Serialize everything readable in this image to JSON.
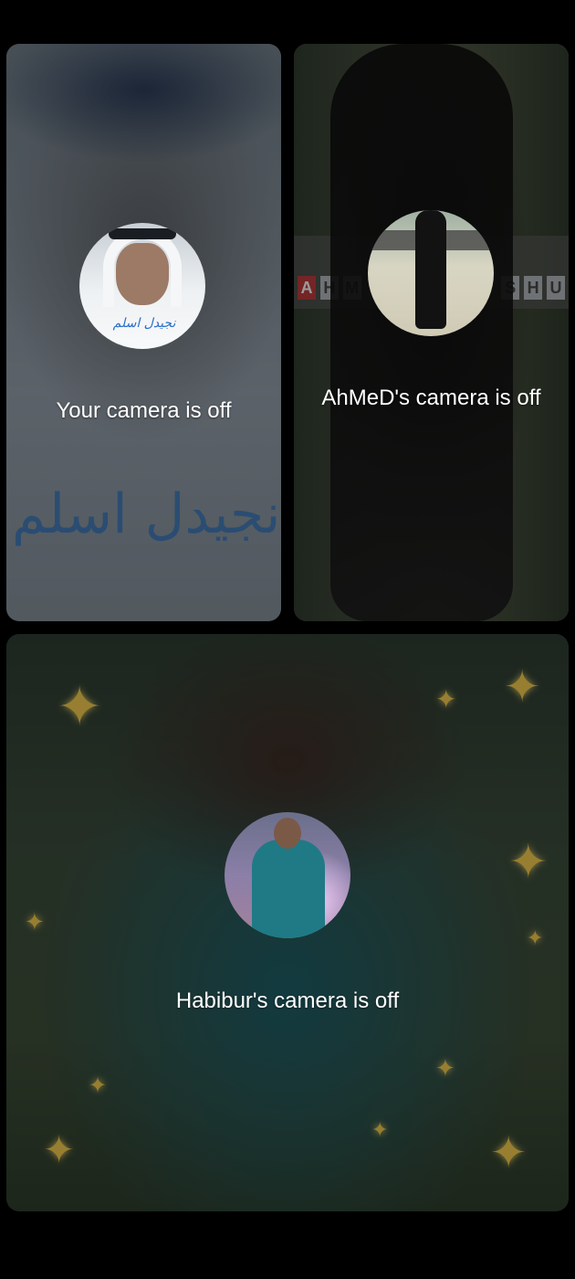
{
  "tiles": {
    "you": {
      "status": "Your camera is off",
      "avatar_caption": "نجيدل اسلم",
      "watermark": "نجيدل اسلم"
    },
    "ahmed": {
      "status": "AhMeD's camera is off",
      "banner_letters": [
        "A",
        "H",
        "M",
        "",
        "",
        "",
        "",
        "",
        "",
        "S",
        "H",
        "U"
      ]
    },
    "habibur": {
      "status": "Habibur's camera is off"
    }
  },
  "colors": {
    "background": "#000000",
    "text": "#ffffff"
  }
}
